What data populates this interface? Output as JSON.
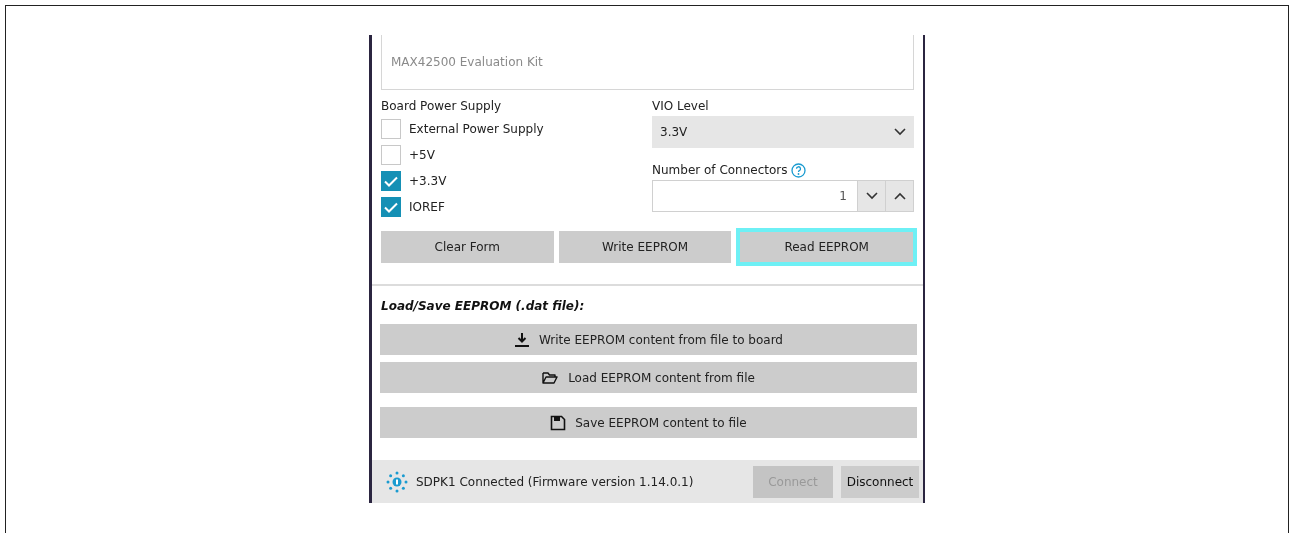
{
  "description_field": {
    "placeholder": "MAX42500 Evaluation Kit"
  },
  "board_power_supply": {
    "label": "Board Power Supply",
    "options": [
      {
        "label": "External Power Supply",
        "checked": false
      },
      {
        "label": "+5V",
        "checked": false
      },
      {
        "label": "+3.3V",
        "checked": true
      },
      {
        "label": "IOREF",
        "checked": true
      }
    ]
  },
  "vio_level": {
    "label": "VIO Level",
    "value": "3.3V"
  },
  "number_of_connectors": {
    "label": "Number of Connectors",
    "value": "1"
  },
  "eeprom_buttons": [
    {
      "label": "Clear Form",
      "focused": false
    },
    {
      "label": "Write EEPROM",
      "focused": false
    },
    {
      "label": "Read EEPROM",
      "focused": true
    }
  ],
  "load_save": {
    "heading": "Load/Save EEPROM (.dat file):",
    "buttons": [
      {
        "kind": "download",
        "label": "Write EEPROM content from file to board"
      },
      {
        "kind": "folder",
        "label": "Load EEPROM content from file"
      },
      {
        "kind": "save",
        "label": "Save EEPROM content to file"
      }
    ]
  },
  "status_bar": {
    "text": "SDPK1 Connected (Firmware version 1.14.0.1)",
    "buttons": [
      {
        "label": "Connect",
        "disabled": true
      },
      {
        "label": "Disconnect",
        "disabled": false
      }
    ]
  }
}
